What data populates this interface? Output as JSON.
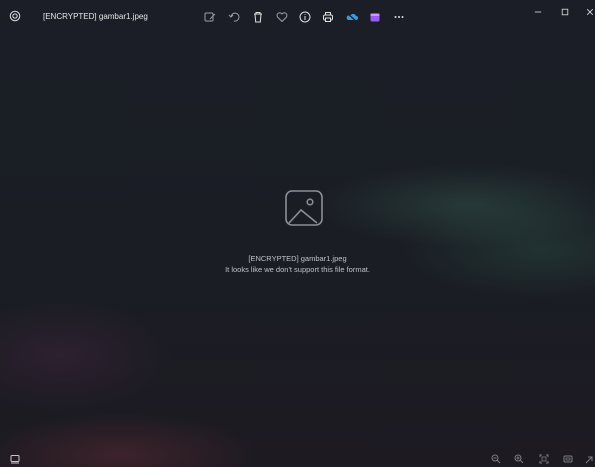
{
  "window": {
    "title": "[ENCRYPTED] gambar1.jpeg",
    "minimize_icon": "minimize-icon",
    "maximize_icon": "maximize-icon",
    "close_icon": "close-icon"
  },
  "toolbar": {
    "app_icon": "photos-app-icon",
    "items": [
      {
        "icon": "edit-image-icon"
      },
      {
        "icon": "rotate-icon"
      },
      {
        "icon": "delete-icon"
      },
      {
        "icon": "favorite-heart-icon"
      },
      {
        "icon": "info-icon"
      },
      {
        "icon": "print-icon"
      },
      {
        "icon": "onedrive-cloud-icon"
      },
      {
        "icon": "clipchamp-icon"
      },
      {
        "icon": "more-options-icon"
      }
    ]
  },
  "viewer": {
    "file_name": "[ENCRYPTED] gambar1.jpeg",
    "error_message": "It looks like we don't support this file format.",
    "placeholder_icon": "image-placeholder-icon"
  },
  "bottombar": {
    "items": [
      {
        "icon": "filmstrip-icon"
      },
      {
        "icon": "zoom-out-icon"
      },
      {
        "icon": "zoom-in-icon"
      },
      {
        "icon": "fit-to-window-icon"
      },
      {
        "icon": "fullscreen-icon"
      },
      {
        "icon": "expand-icon"
      }
    ]
  },
  "colors": {
    "background": "#1a1d24",
    "onedrive_blue": "#3a9bdc",
    "clipchamp_purple": "#9b5cf5"
  }
}
